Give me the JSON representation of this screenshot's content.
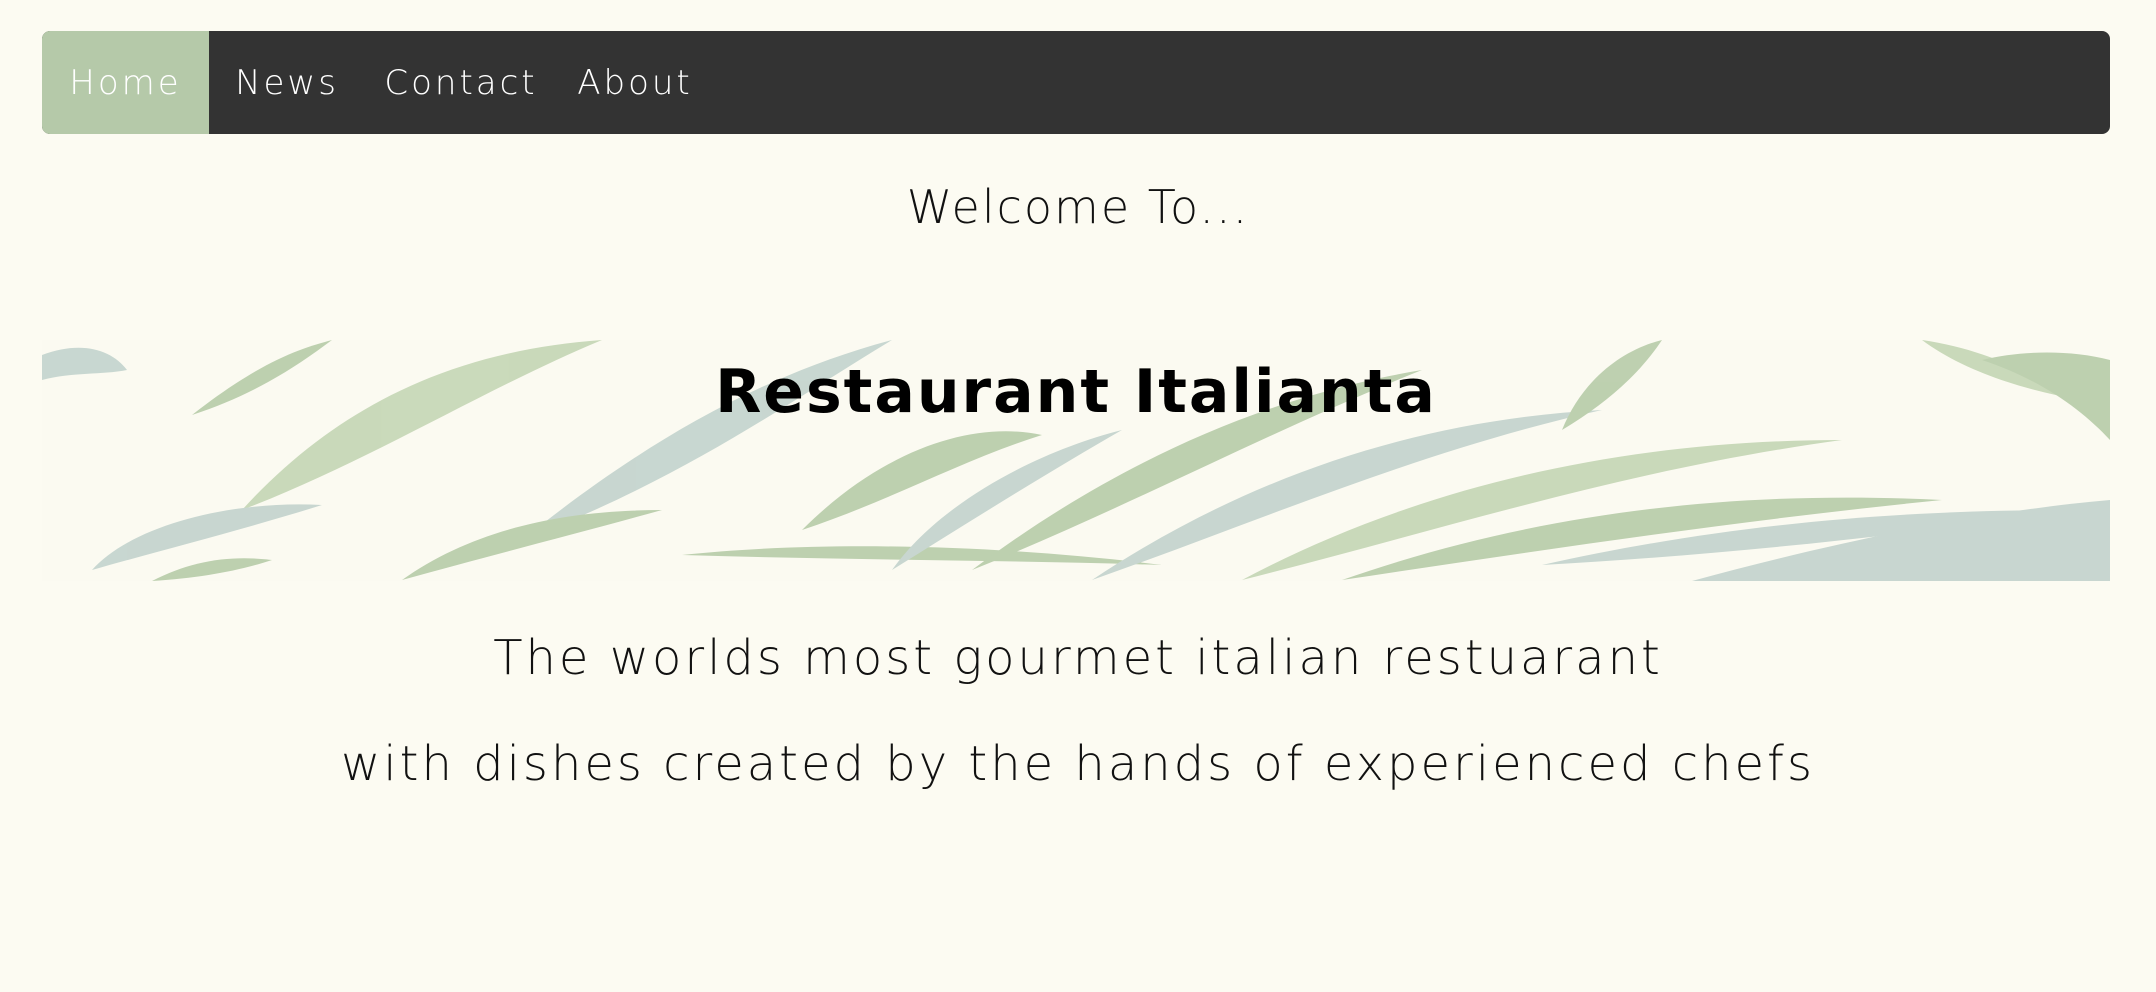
{
  "nav": {
    "items": [
      {
        "label": "Home",
        "active": true
      },
      {
        "label": "News",
        "active": false
      },
      {
        "label": "Contact",
        "active": false
      },
      {
        "label": "About",
        "active": false
      }
    ]
  },
  "hero": {
    "welcome": "Welcome To...",
    "title": "Restaurant Italianta",
    "banner_icon": "watercolor-leaves-image"
  },
  "tagline": {
    "line1": "The worlds most gourmet italian restuarant",
    "line2": "with dishes created by the hands of experienced chefs"
  },
  "colors": {
    "page_bg": "#fcfbf2",
    "nav_bg": "#333333",
    "nav_active_bg": "#b5c9a9",
    "nav_text": "#ffffff",
    "leaf_green": "#a9c29a",
    "leaf_blue": "#b7cbc6"
  }
}
